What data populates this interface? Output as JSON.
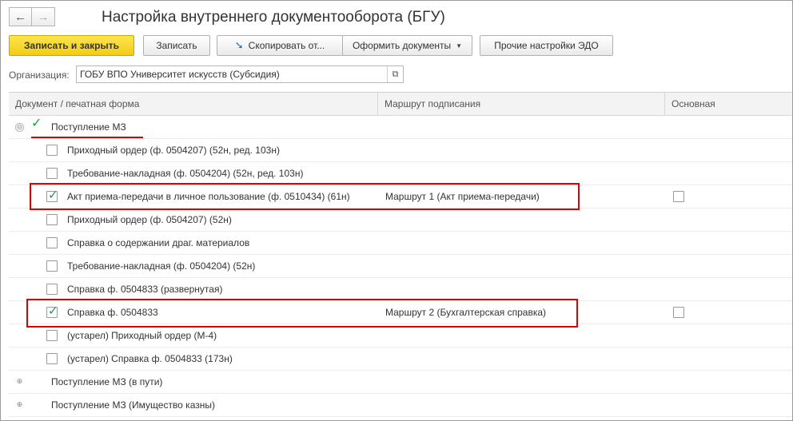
{
  "window": {
    "title": "Настройка внутреннего документооборота (БГУ)",
    "nav_back_icon": "←",
    "nav_forward_icon": "→"
  },
  "toolbar": {
    "save_close": "Записать и закрыть",
    "save": "Записать",
    "copy": "Скопировать от...",
    "copy_icon": "➘",
    "issue_docs": "Оформить документы",
    "caret": "▼",
    "other_settings": "Прочие настройки ЭДО"
  },
  "organization": {
    "label": "Организация:",
    "value": "ГОБУ ВПО Университет искусств (Субсидия)",
    "open_icon": "⧉"
  },
  "table": {
    "columns": [
      "Документ / печатная форма",
      "Маршрут подписания",
      "Основная"
    ],
    "groups": [
      {
        "label": "Поступление МЗ",
        "expanded": true,
        "toggle": "⊖",
        "check": "✓",
        "items": [
          {
            "label": "Приходный ордер (ф. 0504207) (52н, ред. 103н)",
            "checked": false,
            "route": "",
            "main": null
          },
          {
            "label": "Требование-накладная (ф. 0504204) (52н, ред. 103н)",
            "checked": false,
            "route": "",
            "main": null
          },
          {
            "label": "Акт приема-передачи в личное пользование (ф. 0510434) (61н)",
            "checked": true,
            "route": "Маршрут 1 (Акт приема-передачи)",
            "main": false
          },
          {
            "label": "Приходный ордер (ф. 0504207) (52н)",
            "checked": false,
            "route": "",
            "main": null
          },
          {
            "label": "Справка о содержании драг. материалов",
            "checked": false,
            "route": "",
            "main": null
          },
          {
            "label": "Требование-накладная (ф. 0504204) (52н)",
            "checked": false,
            "route": "",
            "main": null
          },
          {
            "label": "Справка ф. 0504833 (развернутая)",
            "checked": false,
            "route": "",
            "main": null
          },
          {
            "label": "Справка ф. 0504833",
            "checked": true,
            "route": "Маршрут 2 (Бухгалтерская справка)",
            "main": false
          },
          {
            "label": "(устарел) Приходный ордер (М-4)",
            "checked": false,
            "route": "",
            "main": null
          },
          {
            "label": "(устарел) Справка ф. 0504833 (173н)",
            "checked": false,
            "route": "",
            "main": null
          }
        ]
      },
      {
        "label": "Поступление МЗ (в пути)",
        "expanded": false,
        "toggle": "⊕"
      },
      {
        "label": "Поступление МЗ (Имущество казны)",
        "expanded": false,
        "toggle": "⊕"
      }
    ]
  },
  "colors": {
    "primary_button": "#f2cd13",
    "highlight": "#e00000",
    "check": "#1f9b3a"
  }
}
